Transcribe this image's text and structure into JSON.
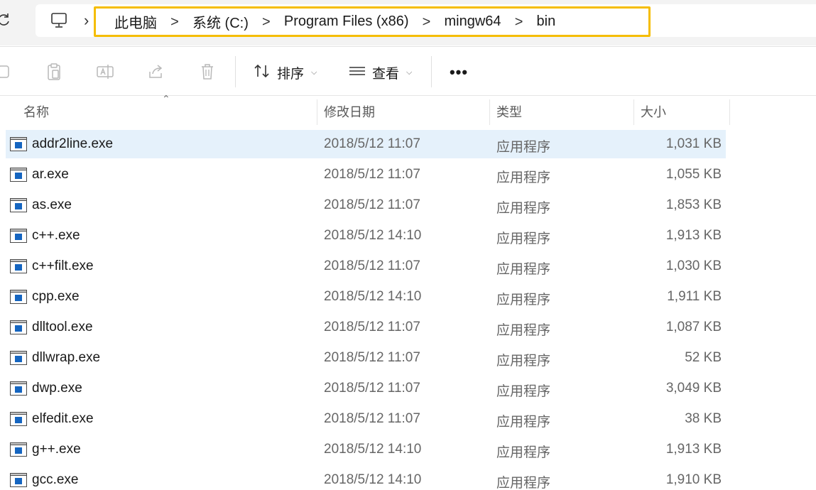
{
  "address": {
    "crumbs": [
      "此电脑",
      "系统 (C:)",
      "Program Files (x86)",
      "mingw64",
      "bin"
    ],
    "separator": ">"
  },
  "toolbar": {
    "sort_label": "排序",
    "view_label": "查看",
    "more_label": "•••"
  },
  "columns": {
    "name": "名称",
    "modified": "修改日期",
    "type": "类型",
    "size": "大小"
  },
  "colors": {
    "highlight_border": "#f5bd00",
    "selected_row": "#e5f1fb"
  },
  "files": [
    {
      "name": "addr2line.exe",
      "modified": "2018/5/12 11:07",
      "type": "应用程序",
      "size": "1,031 KB",
      "selected": true
    },
    {
      "name": "ar.exe",
      "modified": "2018/5/12 11:07",
      "type": "应用程序",
      "size": "1,055 KB"
    },
    {
      "name": "as.exe",
      "modified": "2018/5/12 11:07",
      "type": "应用程序",
      "size": "1,853 KB"
    },
    {
      "name": "c++.exe",
      "modified": "2018/5/12 14:10",
      "type": "应用程序",
      "size": "1,913 KB"
    },
    {
      "name": "c++filt.exe",
      "modified": "2018/5/12 11:07",
      "type": "应用程序",
      "size": "1,030 KB"
    },
    {
      "name": "cpp.exe",
      "modified": "2018/5/12 14:10",
      "type": "应用程序",
      "size": "1,911 KB"
    },
    {
      "name": "dlltool.exe",
      "modified": "2018/5/12 11:07",
      "type": "应用程序",
      "size": "1,087 KB"
    },
    {
      "name": "dllwrap.exe",
      "modified": "2018/5/12 11:07",
      "type": "应用程序",
      "size": "52 KB"
    },
    {
      "name": "dwp.exe",
      "modified": "2018/5/12 11:07",
      "type": "应用程序",
      "size": "3,049 KB"
    },
    {
      "name": "elfedit.exe",
      "modified": "2018/5/12 11:07",
      "type": "应用程序",
      "size": "38 KB"
    },
    {
      "name": "g++.exe",
      "modified": "2018/5/12 14:10",
      "type": "应用程序",
      "size": "1,913 KB"
    },
    {
      "name": "gcc.exe",
      "modified": "2018/5/12 14:10",
      "type": "应用程序",
      "size": "1,910 KB"
    }
  ]
}
